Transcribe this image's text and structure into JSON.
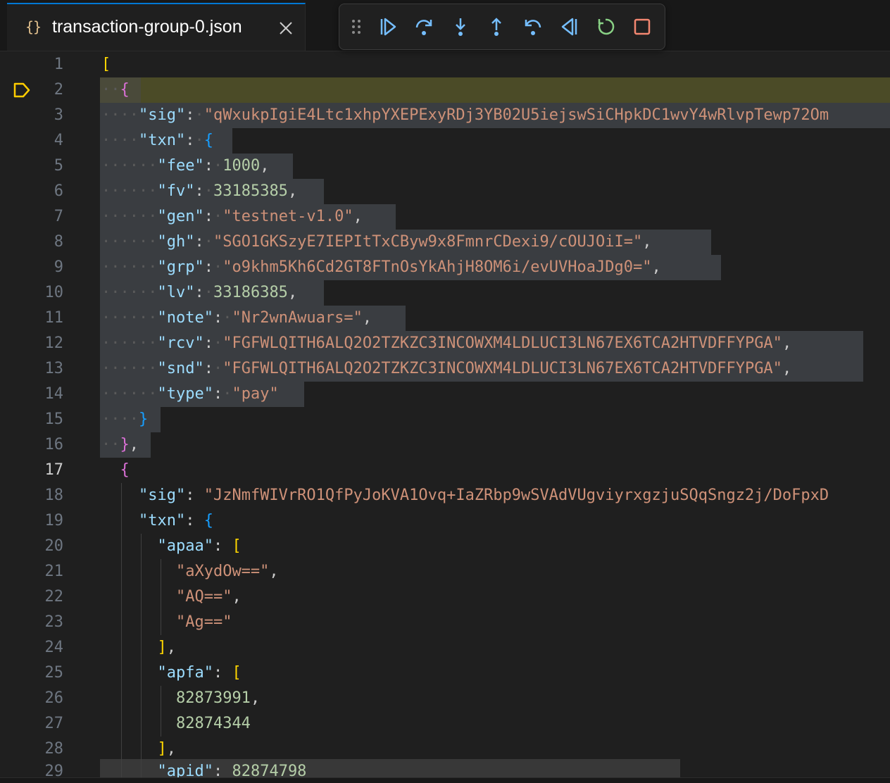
{
  "tab": {
    "icon": "{}",
    "icon_name": "json-braces-icon",
    "filename": "transaction-group-0.json"
  },
  "debug_toolbar": {
    "buttons": [
      {
        "name": "drag-handle-icon"
      },
      {
        "name": "continue-icon"
      },
      {
        "name": "step-over-icon"
      },
      {
        "name": "step-into-icon"
      },
      {
        "name": "step-out-icon"
      },
      {
        "name": "step-back-icon"
      },
      {
        "name": "reverse-icon"
      },
      {
        "name": "restart-icon"
      },
      {
        "name": "stop-icon"
      }
    ]
  },
  "editor": {
    "current_line": 17,
    "breakpoint_line": 2,
    "lines": [
      {
        "n": "1"
      },
      {
        "n": "2"
      },
      {
        "n": "3"
      },
      {
        "n": "4"
      },
      {
        "n": "5"
      },
      {
        "n": "6"
      },
      {
        "n": "7"
      },
      {
        "n": "8"
      },
      {
        "n": "9"
      },
      {
        "n": "10"
      },
      {
        "n": "11"
      },
      {
        "n": "12"
      },
      {
        "n": "13"
      },
      {
        "n": "14"
      },
      {
        "n": "15"
      },
      {
        "n": "16"
      },
      {
        "n": "17"
      },
      {
        "n": "18"
      },
      {
        "n": "19"
      },
      {
        "n": "20"
      },
      {
        "n": "21"
      },
      {
        "n": "22"
      },
      {
        "n": "23"
      },
      {
        "n": "24"
      },
      {
        "n": "25"
      },
      {
        "n": "26"
      },
      {
        "n": "27"
      },
      {
        "n": "28"
      },
      {
        "n": "29"
      }
    ],
    "text": {
      "l1_open": "[",
      "l2_open": "{",
      "l3_key": "\"sig\"",
      "l3_val": "\"qWxukpIgiE4Ltc1xhpYXEPExyRDj3YB02U5iejswSiCHpkDC1wvY4wRlvpTewp72Om",
      "l4_key": "\"txn\"",
      "l4_open": "{",
      "l5_key": "\"fee\"",
      "l5_val": "1000",
      "l6_key": "\"fv\"",
      "l6_val": "33185385",
      "l7_key": "\"gen\"",
      "l7_val": "\"testnet-v1.0\"",
      "l8_key": "\"gh\"",
      "l8_val": "\"SGO1GKSzyE7IEPItTxCByw9x8FmnrCDexi9/cOUJOiI=\"",
      "l9_key": "\"grp\"",
      "l9_val": "\"o9khm5Kh6Cd2GT8FTnOsYkAhjH8OM6i/evUVHoaJDg0=\"",
      "l10_key": "\"lv\"",
      "l10_val": "33186385",
      "l11_key": "\"note\"",
      "l11_val": "\"Nr2wnAwuars=\"",
      "l12_key": "\"rcv\"",
      "l12_val": "\"FGFWLQITH6ALQ2O2TZKZC3INCOWXM4LDLUCI3LN67EX6TCA2HTVDFFYPGA\"",
      "l13_key": "\"snd\"",
      "l13_val": "\"FGFWLQITH6ALQ2O2TZKZC3INCOWXM4LDLUCI3LN67EX6TCA2HTVDFFYPGA\"",
      "l14_key": "\"type\"",
      "l14_val": "\"pay\"",
      "l15_close": "}",
      "l16_close": "}",
      "l17_open": "{",
      "l18_key": "\"sig\"",
      "l18_val": "\"JzNmfWIVrRO1QfPyJoKVA1Ovq+IaZRbp9wSVAdVUgviyrxgzjuSQqSngz2j/DoFpxD",
      "l19_key": "\"txn\"",
      "l19_open": "{",
      "l20_key": "\"apaa\"",
      "l20_open": "[",
      "l21_val": "\"aXydOw==\"",
      "l22_val": "\"AQ==\"",
      "l23_val": "\"Ag==\"",
      "l24_close": "]",
      "l25_key": "\"apfa\"",
      "l25_open": "[",
      "l26_val": "82873991",
      "l27_val": "82874344",
      "l28_close": "]",
      "l29_key": "\"apid\"",
      "l29_val": "82874798"
    }
  },
  "colors": {
    "background": "#1f1f1f",
    "key": "#9cdcfe",
    "string": "#ce9178",
    "number": "#b5cea8",
    "bracket_level1": "#ffd700",
    "bracket_level2": "#da70d6",
    "bracket_level3": "#179fff",
    "current_line_highlight": "#4b4b27",
    "selection": "#3a3d41",
    "accent": "#0078d4"
  }
}
